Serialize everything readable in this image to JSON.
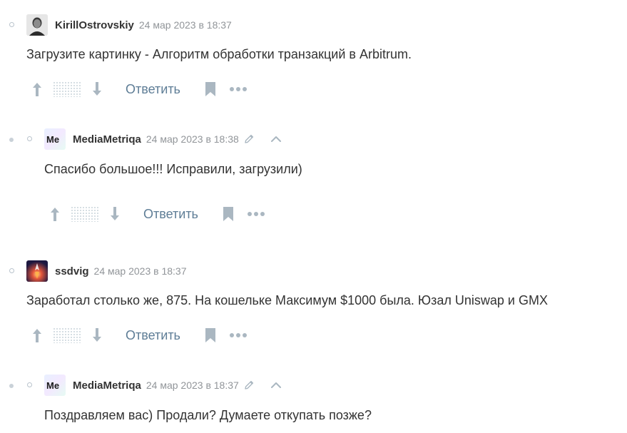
{
  "comments": [
    {
      "username": "KirillOstrovskiy",
      "date": "24 мар 2023 в 18:37",
      "text": "Загрузите картинку - Алгоритм обработки транзакций в Arbitrum.",
      "reply_label": "Ответить"
    },
    {
      "username": "MediaMetriqa",
      "avatar_text": "Me",
      "date": "24 мар 2023 в 18:38",
      "text": "Спасибо большое!!! Исправили, загрузили)",
      "reply_label": "Ответить"
    },
    {
      "username": "ssdvig",
      "date": "24 мар 2023 в 18:37",
      "text": "Заработал столько же, 875. На кошельке Максимум $1000 была. Юзал Uniswap и GMX",
      "reply_label": "Ответить"
    },
    {
      "username": "MediaMetriqa",
      "avatar_text": "Me",
      "date": "24 мар 2023 в 18:37",
      "text": "Поздравляем вас) Продали? Думаете откупать позже?"
    }
  ],
  "icons": {
    "vote_up": "arrow-up-icon",
    "vote_score": "hidden-score-icon",
    "vote_down": "arrow-down-icon",
    "bookmark": "bookmark-icon",
    "more": "more-dots-icon",
    "edit": "pencil-icon",
    "collapse": "chevron-up-icon"
  },
  "colors": {
    "link": "#5e7d96",
    "icon": "#aab7c1",
    "meta": "#919599",
    "text": "#333333"
  }
}
